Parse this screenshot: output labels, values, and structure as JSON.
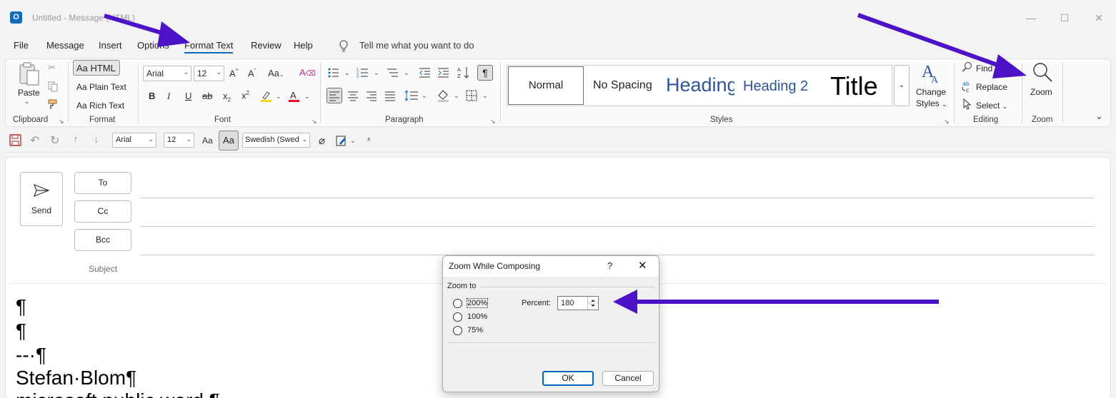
{
  "window": {
    "title": "Untitled  -  Message (HTML)",
    "minimize": "—",
    "maximize": "☐",
    "close": "✕",
    "app_icon": "O"
  },
  "menu": {
    "items": [
      "File",
      "Message",
      "Insert",
      "Options",
      "Format Text",
      "Review",
      "Help"
    ],
    "tell_me": "Tell me what you want to do"
  },
  "ribbon": {
    "clipboard": {
      "paste": "Paste",
      "label": "Clipboard"
    },
    "format": {
      "html": "Aa HTML",
      "plain": "Aa Plain Text",
      "rich": "Aa Rich Text",
      "label": "Format"
    },
    "font": {
      "name": "Arial",
      "size": "12",
      "label": "Font"
    },
    "paragraph": {
      "label": "Paragraph"
    },
    "styles": {
      "items": [
        "Normal",
        "No Spacing",
        "Heading",
        "Heading 2",
        "Title"
      ],
      "change": "Change",
      "change2": "Styles",
      "label": "Styles"
    },
    "editing": {
      "find": "Find",
      "replace": "Replace",
      "select": "Select",
      "label": "Editing"
    },
    "zoom": {
      "button": "Zoom",
      "label": "Zoom"
    }
  },
  "qat": {
    "font": "Arial",
    "size": "12",
    "language": "Swedish (Swed"
  },
  "compose": {
    "send": "Send",
    "to": "To",
    "cc": "Cc",
    "bcc": "Bcc",
    "subject": "Subject",
    "body_lines": [
      "¶",
      "¶",
      "--·¶",
      "Stefan·Blom¶",
      "microsoft.public.word.¶"
    ]
  },
  "dialog": {
    "title": "Zoom While Composing",
    "help": "?",
    "close": "✕",
    "zoom_to": "Zoom to",
    "options": [
      "200%",
      "100%",
      "75%"
    ],
    "percent_label": "Percent:",
    "percent_value": "180",
    "ok": "OK",
    "cancel": "Cancel"
  },
  "colors": {
    "accent": "#0f6cbd",
    "annotation_arrow": "#4b12c8",
    "highlight": "#ffd700",
    "font_color": "#e81123"
  }
}
